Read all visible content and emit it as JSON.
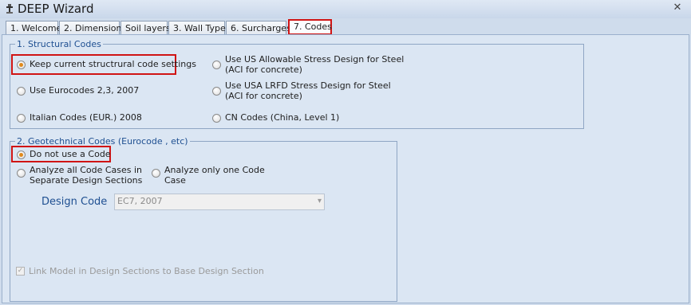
{
  "window": {
    "title": "DEEP Wizard"
  },
  "tabs": [
    {
      "label": "1. Welcome"
    },
    {
      "label": "2. Dimensions"
    },
    {
      "label": "Soil layers"
    },
    {
      "label": "3. Wall Type"
    },
    {
      "label": "6. Surcharges"
    },
    {
      "label": "7. Codes"
    }
  ],
  "structural": {
    "legend": "1. Structural Codes",
    "options": [
      {
        "line1": "Keep current structrural code settings",
        "line2": "",
        "selected": true
      },
      {
        "line1": "Use US Allowable Stress Design for Steel",
        "line2": "(ACI for concrete)",
        "selected": false
      },
      {
        "line1": "Use Eurocodes 2,3, 2007",
        "line2": "",
        "selected": false
      },
      {
        "line1": "Use USA LRFD Stress Design for Steel",
        "line2": "(ACI for concrete)",
        "selected": false
      },
      {
        "line1": "Italian Codes (EUR.) 2008",
        "line2": "",
        "selected": false
      },
      {
        "line1": "CN Codes (China, Level 1)",
        "line2": "",
        "selected": false
      }
    ]
  },
  "geotechnical": {
    "legend": "2. Geotechnical Codes (Eurocode , etc)",
    "options": [
      {
        "line1": "Do not use a Code",
        "line2": "",
        "selected": true
      },
      {
        "line1": "Analyze all Code Cases in",
        "line2": "Separate Design Sections",
        "selected": false
      },
      {
        "line1": "Analyze only one Code",
        "line2": "Case",
        "selected": false
      }
    ],
    "design_code_label": "Design Code",
    "design_code_value": "EC7, 2007",
    "link_checkbox_label": "Link Model in Design Sections to Base Design Section"
  }
}
